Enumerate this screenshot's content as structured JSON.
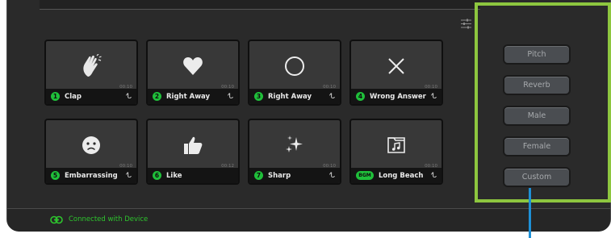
{
  "status_bar": {
    "text": "Connected with Device",
    "icon": "link-icon",
    "color": "#2ec42e"
  },
  "settings": {
    "icon": "sliders-icon"
  },
  "pads": [
    {
      "number": "1",
      "label": "Clap",
      "duration": "00:10",
      "icon": "clapping-hands-icon"
    },
    {
      "number": "2",
      "label": "Right Away",
      "duration": "00:10",
      "icon": "heart-icon"
    },
    {
      "number": "3",
      "label": "Right Away",
      "duration": "00:10",
      "icon": "circle-icon"
    },
    {
      "number": "4",
      "label": "Wrong Answer",
      "duration": "00:10",
      "icon": "x-icon"
    },
    {
      "number": "5",
      "label": "Embarrassing",
      "duration": "00:10",
      "icon": "sad-face-icon"
    },
    {
      "number": "6",
      "label": "Like",
      "duration": "00:12",
      "icon": "thumbs-up-icon"
    },
    {
      "number": "7",
      "label": "Sharp",
      "duration": "00:10",
      "icon": "sparkles-icon"
    },
    {
      "number": "BGM",
      "label": "Long Beach",
      "duration": "00:10",
      "icon": "music-folder-icon"
    }
  ],
  "pad_loop_icon": "repeat-icon",
  "effects": [
    {
      "label": "Pitch"
    },
    {
      "label": "Reverb"
    },
    {
      "label": "Male"
    },
    {
      "label": "Female"
    },
    {
      "label": "Custom"
    }
  ],
  "colors": {
    "accent_green": "#1fbf3a",
    "highlight_border": "#8dc63f",
    "callout_line": "#1e90d6"
  }
}
